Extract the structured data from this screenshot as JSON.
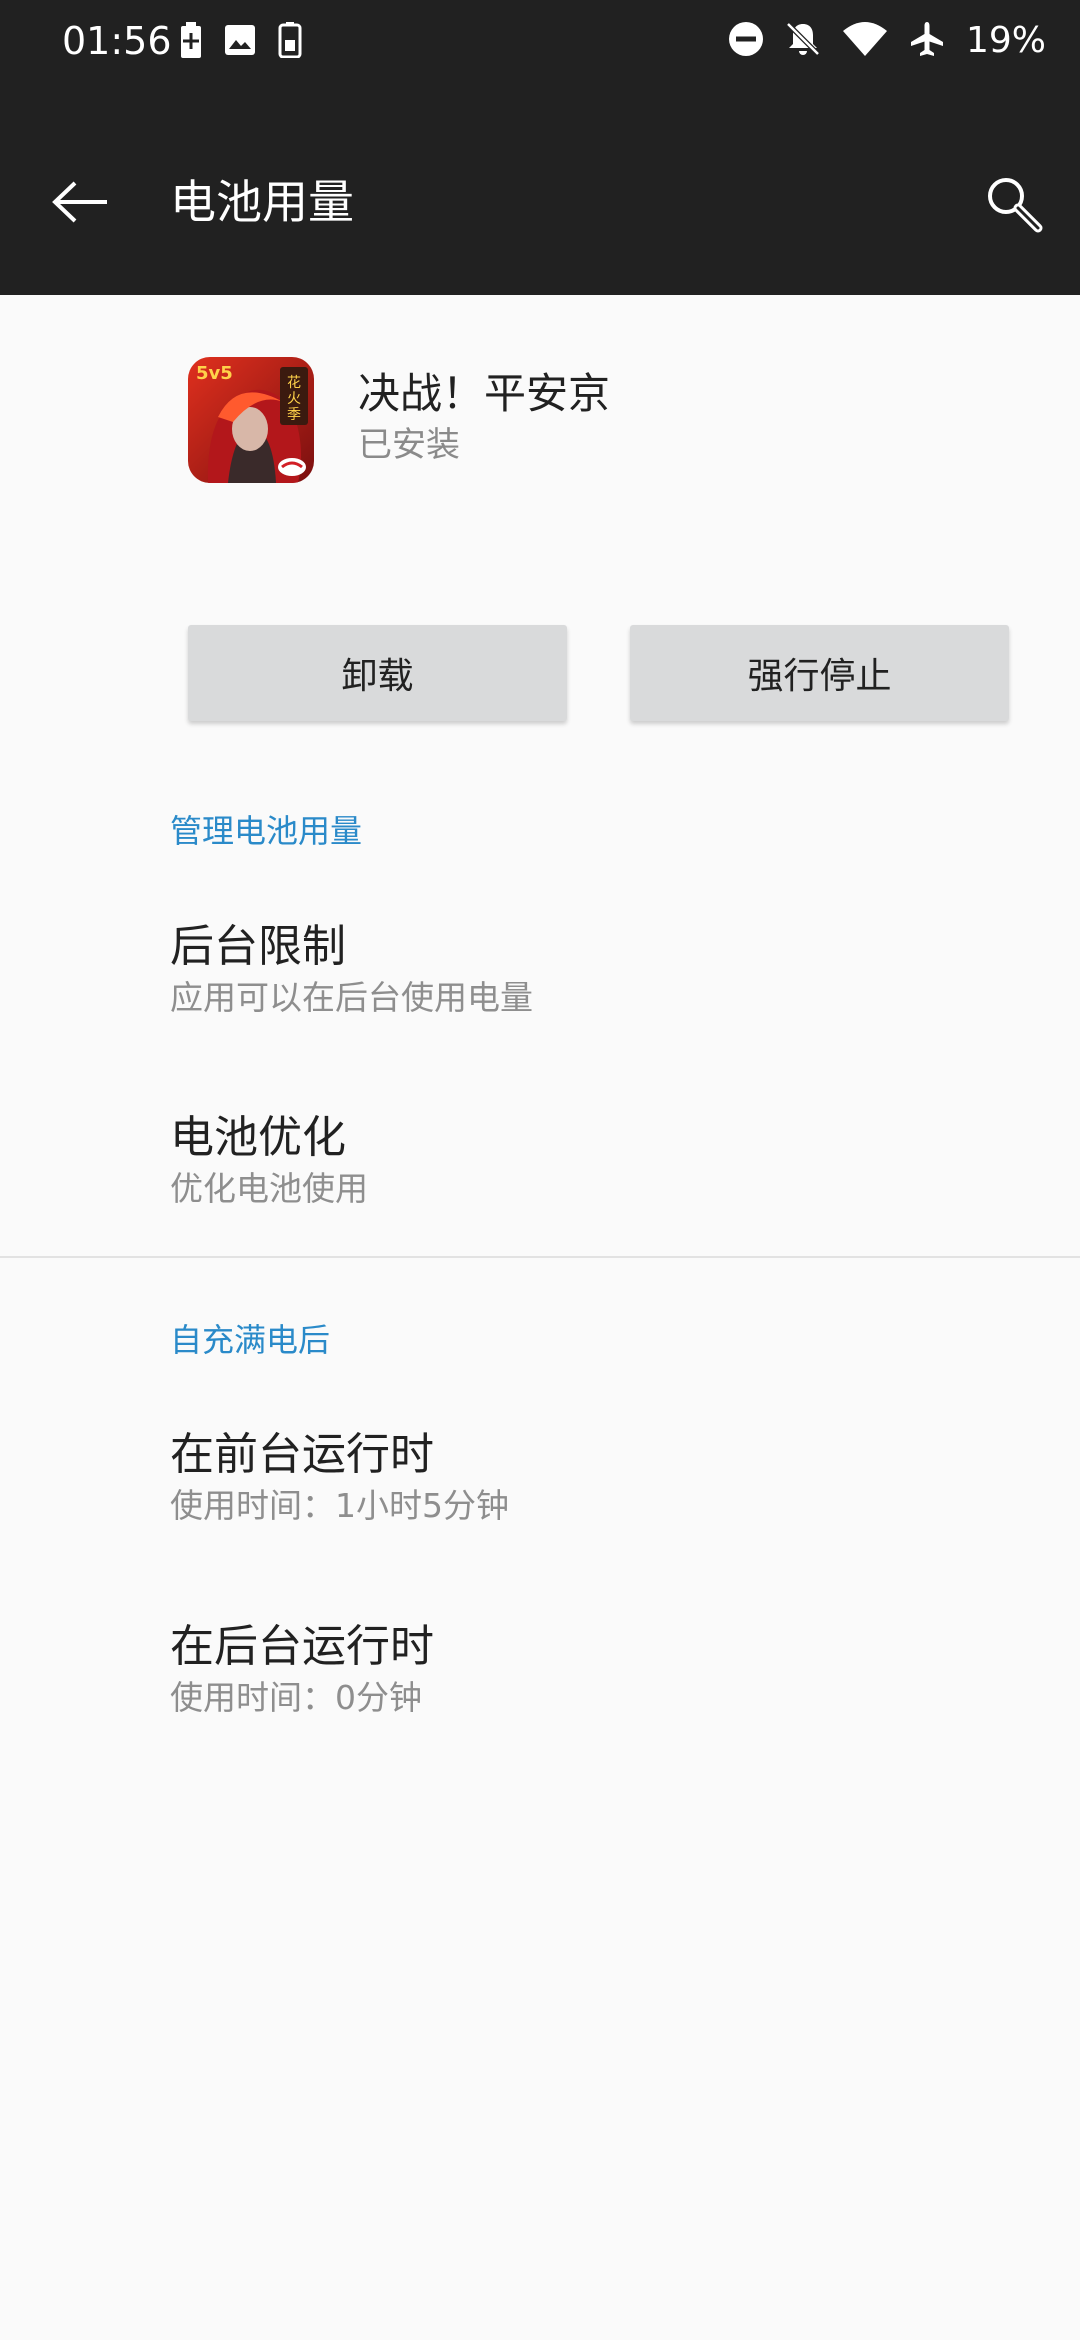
{
  "status_bar": {
    "time": "01:56",
    "left_icons": [
      "battery-charging-icon",
      "image-icon",
      "battery-saver-icon"
    ],
    "right_icons": [
      "do-not-disturb-icon",
      "notifications-off-icon",
      "wifi-icon",
      "airplane-icon"
    ],
    "battery_percent": "19%"
  },
  "toolbar": {
    "title": "电池用量",
    "back_icon": "arrow-left-icon",
    "search_icon": "search-icon"
  },
  "app": {
    "name": "决战！平安京",
    "status": "已安装",
    "icon_text_top": "5v5",
    "icon_text_side": "花火季"
  },
  "buttons": {
    "uninstall": "卸载",
    "force_stop": "强行停止"
  },
  "sections": {
    "manage": {
      "header": "管理电池用量",
      "items": [
        {
          "title": "后台限制",
          "summary": "应用可以在后台使用电量"
        },
        {
          "title": "电池优化",
          "summary": "优化电池使用"
        }
      ]
    },
    "since_full": {
      "header": "自充满电后",
      "items": [
        {
          "title": "在前台运行时",
          "summary": "使用时间：1小时5分钟"
        },
        {
          "title": "在后台运行时",
          "summary": "使用时间：0分钟"
        }
      ]
    }
  },
  "colors": {
    "toolbar_bg": "#212121",
    "accent": "#2a8ac9",
    "background": "#fafafa",
    "button_bg": "#d9dadb"
  }
}
